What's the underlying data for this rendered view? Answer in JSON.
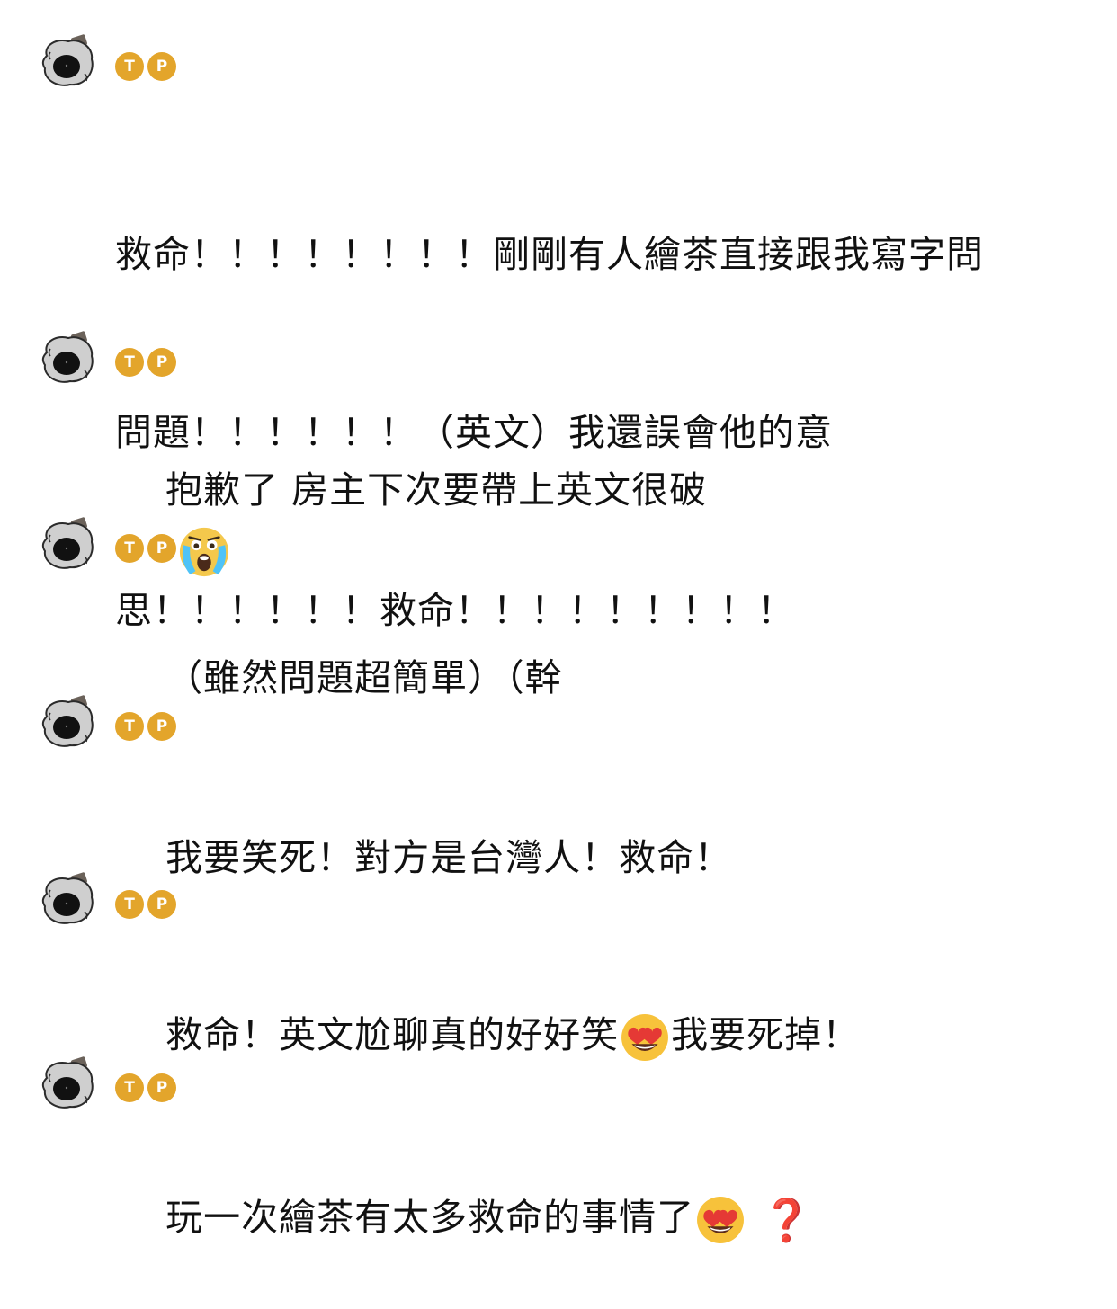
{
  "messages": [
    {
      "user": {
        "badge_1": "T",
        "badge_2": "P"
      },
      "line_1": "救命！！！！！！！！剛剛有人繪茶直接跟我寫字問",
      "line_2": "問題！！！！！！（英文）我還誤會他的意",
      "line_3": "思！！！！！！救命！！！！！！！！！"
    },
    {
      "user": {
        "badge_1": "T",
        "badge_2": "P"
      },
      "text": "抱歉了 房主下次要帶上英文很破",
      "emoji": "loudly-crying-face-icon"
    },
    {
      "user": {
        "badge_1": "T",
        "badge_2": "P"
      },
      "text": "（雖然問題超簡單）（幹"
    },
    {
      "user": {
        "badge_1": "T",
        "badge_2": "P"
      },
      "text": "我要笑死！對方是台灣人！救命！"
    },
    {
      "user": {
        "badge_1": "T",
        "badge_2": "P"
      },
      "text_before": "救命！英文尬聊真的好好笑",
      "emoji": "heart-eyes-icon",
      "text_after": "我要死掉！"
    },
    {
      "user": {
        "badge_1": "T",
        "badge_2": "P"
      },
      "text": "玩一次繪茶有太多救命的事情了",
      "emoji": "heart-eyes-icon",
      "trailing_mark": "❓"
    }
  ],
  "colors": {
    "badge": "#e3a52b",
    "text": "#111111",
    "question_mark": "#d31f1f"
  }
}
